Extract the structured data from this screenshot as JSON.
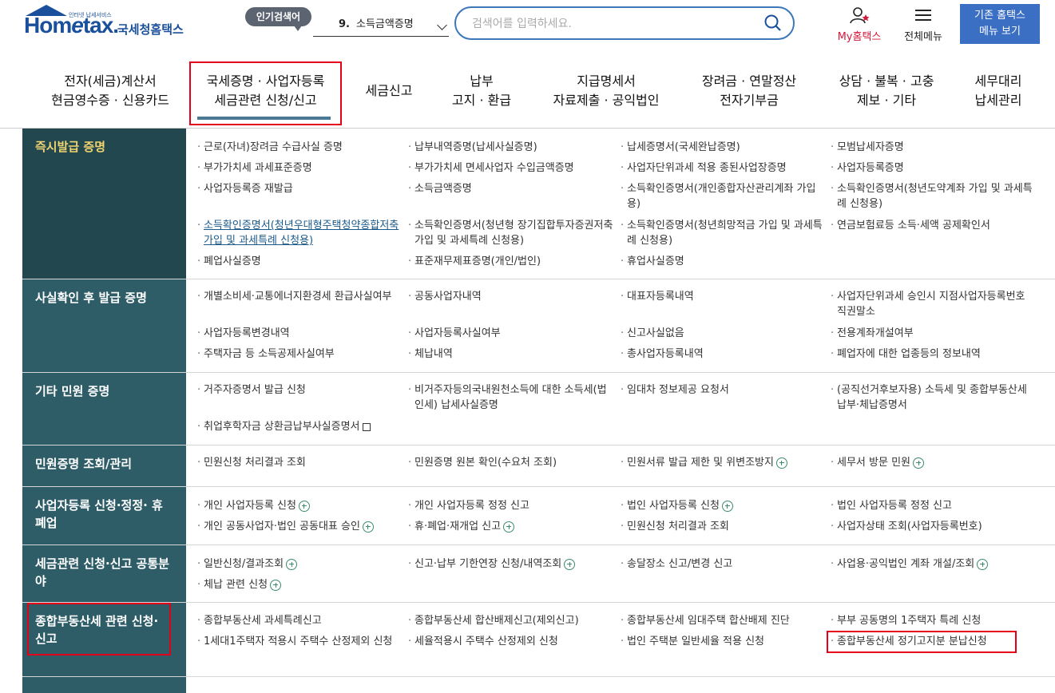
{
  "header": {
    "logo_small": "인터넷 납세서비스",
    "logo_home": "Hom",
    "logo_e": "e",
    "logo_tax": "tax.",
    "logo_name": "국세청홈택스",
    "popular_badge": "인기검색어",
    "popular_num": "9.",
    "popular_term": "소득금액증명",
    "search_placeholder": "검색어를 입력하세요.",
    "myhome": "My홈택스",
    "allmenu": "전체메뉴",
    "old_btn_line1": "기존 홈택스",
    "old_btn_line2": "메뉴 보기"
  },
  "gnb": [
    {
      "l1": "전자(세금)계산서",
      "l2": "현금영수증 · 신용카드"
    },
    {
      "l1": "국세증명 · 사업자등록",
      "l2": "세금관련 신청/신고"
    },
    {
      "l1": "세금신고",
      "l2": ""
    },
    {
      "l1": "납부",
      "l2": "고지 · 환급"
    },
    {
      "l1": "지급명세서",
      "l2": "자료제출 · 공익법인"
    },
    {
      "l1": "장려금 · 연말정산",
      "l2": "전자기부금"
    },
    {
      "l1": "상담 · 불복 · 고충",
      "l2": "제보 · 기타"
    },
    {
      "l1": "세무대리",
      "l2": "납세관리"
    }
  ],
  "rows": [
    {
      "head": "즉시발급 증명",
      "items": [
        "근로(자녀)장려금 수급사실 증명",
        "납부내역증명(납세사실증명)",
        "납세증명서(국세완납증명)",
        "모범납세자증명",
        "부가가치세 과세표준증명",
        "부가가치세 면세사업자 수입금액증명",
        "사업자단위과세 적용 종된사업장증명",
        "사업자등록증명",
        "사업자등록증 재발급",
        "소득금액증명",
        "소득확인증명서(개인종합자산관리계좌 가입용)",
        "소득확인증명서(청년도약계좌 가입 및 과세특례 신청용)",
        "소득확인증명서(청년우대형주택청약종합저축 가입 및 과세특례 신청용)",
        "소득확인증명서(청년형 장기집합투자증권저축 가입 및 과세특례 신청용)",
        "소득확인증명서(청년희망적금 가입 및 과세특례 신청용)",
        "연금보험료등 소득·세액 공제확인서",
        "폐업사실증명",
        "표준재무제표증명(개인/법인)",
        "휴업사실증명"
      ]
    },
    {
      "head": "사실확인 후 발급 증명",
      "items": [
        "개별소비세·교통에너지환경세 환급사실여부",
        "공동사업자내역",
        "대표자등록내역",
        "사업자단위과세 승인시 지점사업자등록번호 직권말소",
        "사업자등록변경내역",
        "사업자등록사실여부",
        "신고사실없음",
        "전용계좌개설여부",
        "주택자금 등 소득공제사실여부",
        "체납내역",
        "총사업자등록내역",
        "폐업자에 대한 업종등의 정보내역"
      ]
    },
    {
      "head": "기타 민원 증명",
      "items": [
        "거주자증명서 발급 신청",
        "비거주자등의국내원천소득에 대한 소득세(법인세) 납세사실증명",
        "임대차 정보제공 요청서",
        "(공직선거후보자용) 소득세 및 종합부동산세 납부·체납증명서",
        "취업후학자금 상환금납부사실증명서"
      ]
    },
    {
      "head": "민원증명 조회/관리",
      "items": [
        "민원신청 처리결과 조회",
        "민원증명 원본 확인(수요처 조회)",
        "민원서류 발급 제한 및 위변조방지",
        "세무서 방문 민원"
      ]
    },
    {
      "head": "사업자등록 신청·정정· 휴폐업",
      "items": [
        "개인 사업자등록 신청",
        "개인 사업자등록 정정 신고",
        "법인 사업자등록 신청",
        "법인 사업자등록 정정 신고",
        "개인 공동사업자·법인 공동대표 승인",
        "휴·폐업·재개업 신고",
        "민원신청 처리결과 조회",
        "사업자상태 조회(사업자등록번호)"
      ]
    },
    {
      "head": "세금관련 신청·신고 공통분야",
      "items": [
        "일반신청/결과조회",
        "신고·납부 기한연장 신청/내역조회",
        "송달장소 신고/변경 신고",
        "사업용·공익법인 계좌 개설/조회",
        "체납 관련 신청"
      ]
    },
    {
      "head": "종합부동산세 관련 신청· 신고",
      "items": [
        "종합부동산세 과세특례신고",
        "종합부동산세 합산배제신고(제외신고)",
        "종합부동산세 임대주택 합산배제 진단",
        "부부 공동명의 1주택자 특례 신청",
        "1세대1주택자 적용시 주택수 산정제외 신청",
        "세율적용시 주택수 산정제외 신청",
        "법인 주택분 일반세율 적용 신청",
        "종합부동산세 정기고지분 분납신청"
      ]
    }
  ]
}
